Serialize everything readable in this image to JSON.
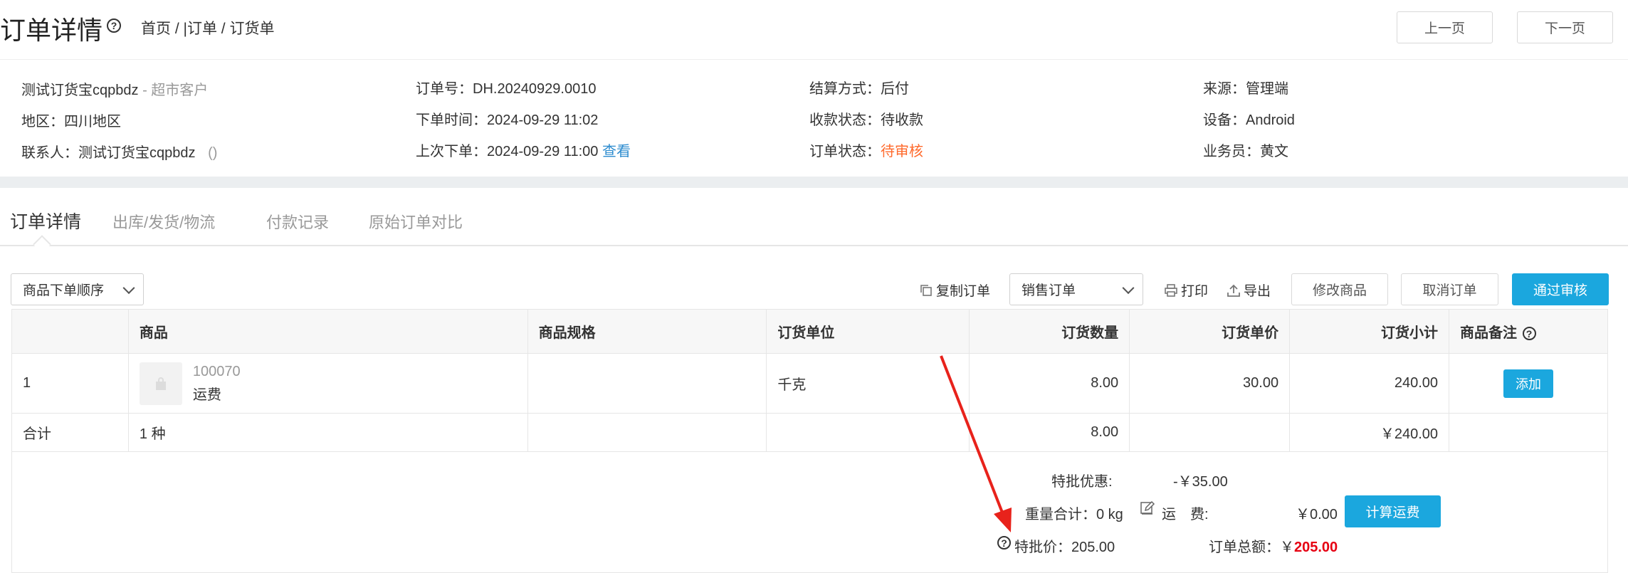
{
  "header": {
    "title": "订单详情",
    "help_symbol": "?",
    "breadcrumb": "首页 / |订单 / 订货单",
    "prev_button": "上一页",
    "next_button": "下一页"
  },
  "info": {
    "customer_name": "测试订货宝cqpbdz",
    "customer_type": "- 超市客户",
    "region": "地区：四川地区",
    "contact": "联系人：测试订货宝cqpbdz",
    "contact_phone": "()",
    "order_no": "订单号：DH.20240929.0010",
    "order_time": "下单时间：2024-09-29 11:02",
    "last_order_label": "上次下单：2024-09-29 11:00",
    "last_order_link": "查看",
    "settlement": "结算方式：后付",
    "payment_status": "收款状态：待收款",
    "order_status_label": "订单状态：",
    "order_status_value": "待审核",
    "source": "来源：管理端",
    "device": "设备：Android",
    "salesperson": "业务员：黄文"
  },
  "tabs": [
    {
      "label": "订单详情",
      "active": true
    },
    {
      "label": "出库/发货/物流",
      "active": false
    },
    {
      "label": "付款记录",
      "active": false
    },
    {
      "label": "原始订单对比",
      "active": false
    }
  ],
  "toolbar": {
    "sort_select": "商品下单顺序",
    "copy_order": "复制订单",
    "order_type_select": "销售订单",
    "print": "打印",
    "export": "导出",
    "modify_goods": "修改商品",
    "cancel_order": "取消订单",
    "approve": "通过审核"
  },
  "table": {
    "headers": [
      "",
      "商品",
      "商品规格",
      "订货单位",
      "订货数量",
      "订货单价",
      "订货小计",
      "商品备注"
    ],
    "rows": [
      {
        "index": "1",
        "code": "100070",
        "name": "运费",
        "spec": "",
        "unit": "千克",
        "qty": "8.00",
        "price": "30.00",
        "subtotal": "240.00",
        "note_button": "添加"
      }
    ],
    "total": {
      "label": "合计",
      "kinds": "1 种",
      "qty": "8.00",
      "subtotal": "￥240.00"
    }
  },
  "summary": {
    "special_discount_label": "特批优惠:",
    "special_discount_value": "-￥35.00",
    "weight_label": "重量合计：0 kg",
    "freight_label": "运　费:",
    "freight_value": "￥0.00",
    "calc_freight_button": "计算运费",
    "special_price": "特批价：205.00",
    "total_label": "订单总额：",
    "total_currency": "￥",
    "total_value": "205.00"
  },
  "colors": {
    "primary": "#1ba7de",
    "status_orange": "#ff6a2c",
    "link_blue": "#2d8ccf",
    "total_red": "#e60012",
    "annotation_arrow": "#e8221b"
  }
}
